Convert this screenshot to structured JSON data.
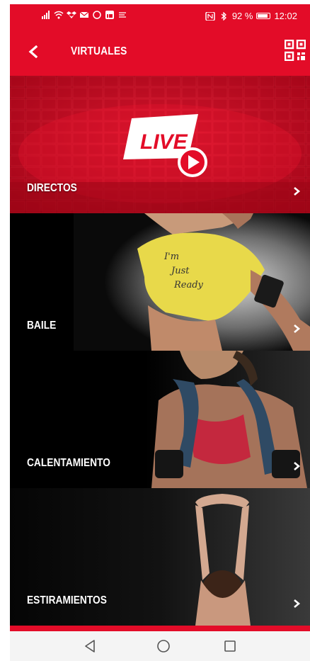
{
  "statusbar": {
    "battery": "92 %",
    "time": "12:02",
    "left_icons": [
      "signal-icon",
      "wifi-icon",
      "dropbox-icon",
      "mail-icon",
      "whatsapp-icon",
      "linkedin-icon",
      "notification-icon"
    ],
    "right_icons": [
      "nfc-icon",
      "bluetooth-icon",
      "battery-icon"
    ]
  },
  "appbar": {
    "title": "VIRTUALES",
    "back_icon": "chevron-left-icon",
    "action_icon": "qr-code-icon"
  },
  "categories": [
    {
      "label": "DIRECTOS",
      "badge": "LIVE"
    },
    {
      "label": "BAILE"
    },
    {
      "label": "CALENTAMIENTO"
    },
    {
      "label": "ESTIRAMIENTOS"
    }
  ],
  "colors": {
    "brand_red": "#e30c28",
    "white": "#ffffff"
  },
  "navbar": {
    "icons": [
      "back-triangle-icon",
      "home-circle-icon",
      "recents-square-icon"
    ]
  }
}
